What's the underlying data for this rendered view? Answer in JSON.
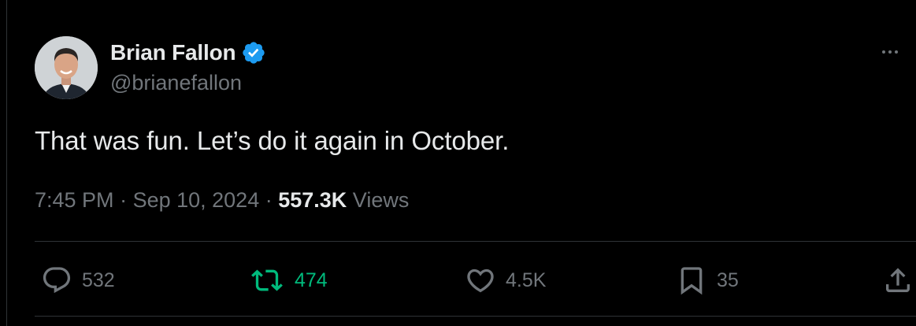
{
  "author": {
    "display_name": "Brian Fallon",
    "handle": "@brianefallon",
    "verified": true,
    "verified_color": "#1d9bf0",
    "avatar_icon": "profile-photo"
  },
  "tweet": {
    "text": "That was fun. Let’s do it again in October."
  },
  "meta": {
    "time": "7:45 PM",
    "separator": " · ",
    "date": "Sep 10, 2024",
    "views_count": "557.3K",
    "views_label": " Views"
  },
  "actions": {
    "replies": {
      "icon": "reply-icon",
      "count": "532"
    },
    "retweets": {
      "icon": "retweet-icon",
      "count": "474",
      "active": true,
      "color": "#00ba7c"
    },
    "likes": {
      "icon": "heart-icon",
      "count": "4.5K"
    },
    "bookmarks": {
      "icon": "bookmark-icon",
      "count": "35"
    },
    "share": {
      "icon": "share-icon"
    }
  },
  "colors": {
    "background": "#000000",
    "primary_text": "#e7e9ea",
    "secondary_text": "#71767b",
    "border": "#2f3336"
  }
}
